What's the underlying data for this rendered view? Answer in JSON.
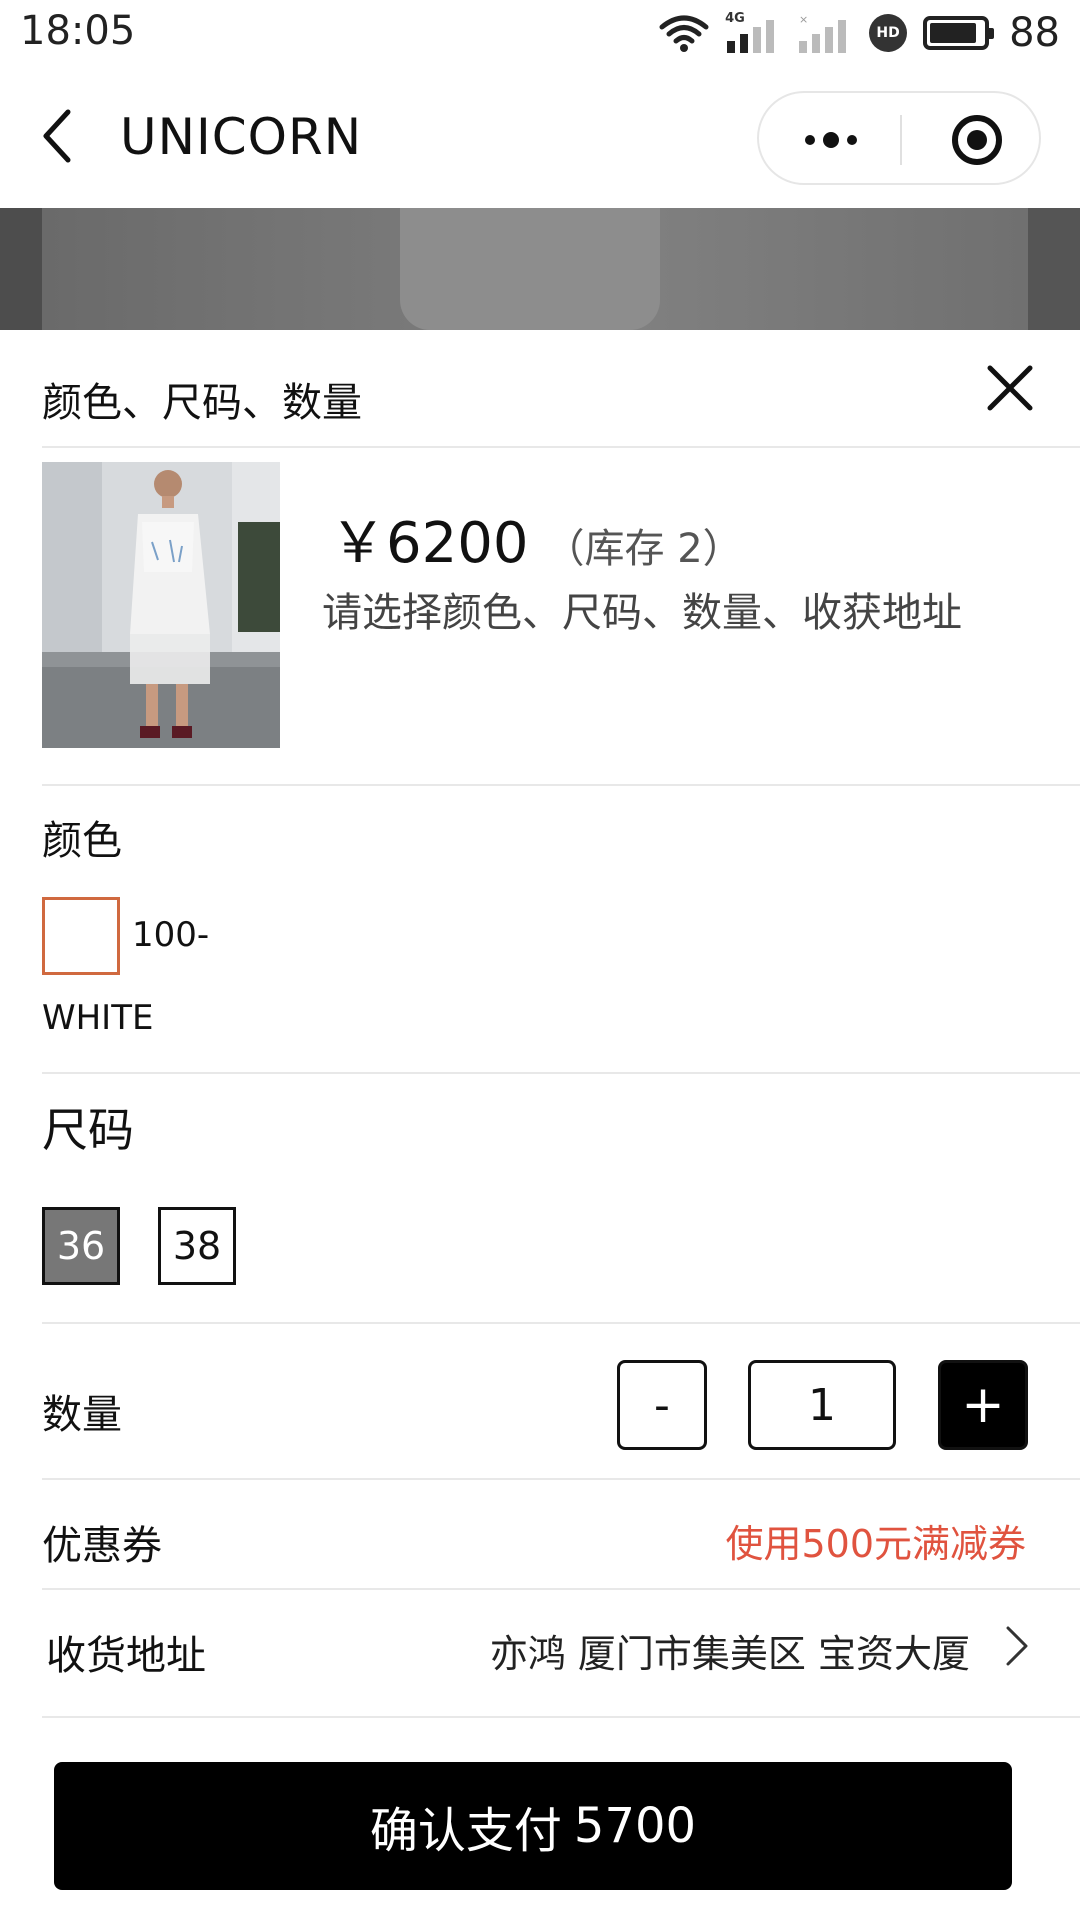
{
  "status_bar": {
    "time": "18:05",
    "network_tag": "4G",
    "battery": "88",
    "hd_badge": "HD",
    "icons": [
      "wifi-icon",
      "signal-icon",
      "hd-icon",
      "battery-icon"
    ]
  },
  "nav": {
    "title": "UNICORN",
    "back_icon": "chevron-left-icon",
    "menu_icon": "more-dots-icon",
    "home_icon": "target-circle-icon"
  },
  "sheet": {
    "title": "颜色、尺码、数量",
    "close_icon": "close-icon",
    "product": {
      "price": "￥6200",
      "stock": "（库存 2）",
      "hint": "请选择颜色、尺码、数量、收获地址"
    },
    "color": {
      "label": "颜色",
      "option_line1": "100-",
      "option_line2": "WHITE",
      "swatch_border_color": "#d0693f"
    },
    "size": {
      "label": "尺码",
      "options": [
        "36",
        "38"
      ],
      "selected": "36"
    },
    "quantity": {
      "label": "数量",
      "minus": "-",
      "value": "1",
      "plus": "+"
    },
    "coupon": {
      "label": "优惠券",
      "value": "使用500元满减券",
      "value_color": "#e0533f"
    },
    "address": {
      "label": "收货地址",
      "value": "亦鸿 厦门市集美区 宝资大厦",
      "chevron_icon": "chevron-right-icon"
    },
    "pay_button": {
      "label": "确认支付",
      "amount": "5700"
    }
  }
}
